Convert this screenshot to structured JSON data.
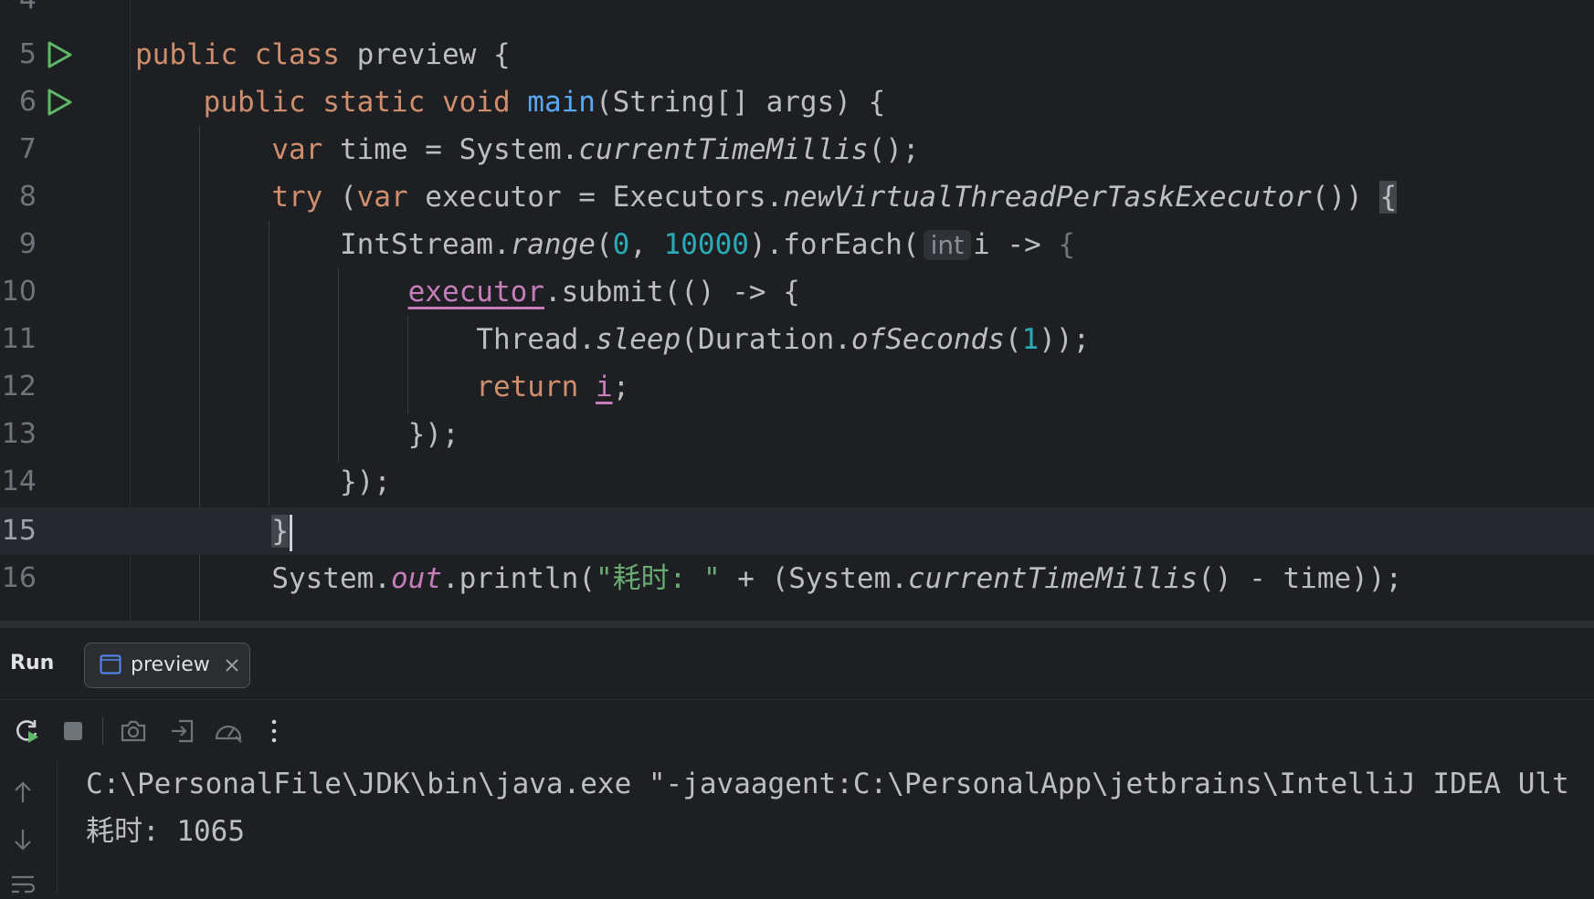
{
  "editor": {
    "lines": [
      {
        "num": "4"
      },
      {
        "num": "5"
      },
      {
        "num": "6"
      },
      {
        "num": "7"
      },
      {
        "num": "8"
      },
      {
        "num": "9"
      },
      {
        "num": "10"
      },
      {
        "num": "11"
      },
      {
        "num": "12"
      },
      {
        "num": "13"
      },
      {
        "num": "14"
      },
      {
        "num": "15"
      },
      {
        "num": "16"
      }
    ],
    "code": {
      "l5": {
        "public": "public",
        "class": "class",
        "name": " preview {"
      },
      "l6": {
        "indent": "    ",
        "public": "public",
        "static": " static",
        "void": " void",
        "main": " main",
        "sig": "(String[] args) {"
      },
      "l7": {
        "indent": "        ",
        "var": "var",
        "rest1": " time = System.",
        "method": "currentTimeMillis",
        "rest2": "();"
      },
      "l8": {
        "indent": "        ",
        "try": "try",
        "paren": " (",
        "var": "var",
        "rest1": " executor = Executors.",
        "method": "newVirtualThreadPerTaskExecutor",
        "rest2": "()) ",
        "brace": "{"
      },
      "l9": {
        "indent": "            ",
        "cls": "IntStream.",
        "range": "range",
        "open": "(",
        "n0": "0",
        "comma": ", ",
        "n1": "10000",
        "rest": ").forEach(",
        "hint": "int",
        "lambda": "i -> ",
        "brace": "{"
      },
      "l10": {
        "indent": "                ",
        "executor": "executor",
        "rest": ".submit(() -> {"
      },
      "l11": {
        "indent": "                    ",
        "cls": "Thread.",
        "sleep": "sleep",
        "mid": "(Duration.",
        "ofSeconds": "ofSeconds",
        "open": "(",
        "n1": "1",
        "close": "));"
      },
      "l12": {
        "indent": "                    ",
        "return": "return",
        "space": " ",
        "i": "i",
        "semi": ";"
      },
      "l13": {
        "indent": "                ",
        "text": "});"
      },
      "l14": {
        "indent": "            ",
        "text": "});"
      },
      "l15": {
        "indent": "        ",
        "brace": "}"
      },
      "l16": {
        "indent": "        ",
        "pre": "System.",
        "out": "out",
        "mid": ".println(",
        "str": "\"耗时: \"",
        "post1": " + (System.",
        "method": "currentTimeMillis",
        "post2": "() - time));"
      }
    }
  },
  "run_panel": {
    "title": "Run",
    "tab_label": "preview",
    "toolbar_icons": [
      "rerun-icon",
      "stop-icon",
      "camera-icon",
      "login-icon",
      "profiler-icon",
      "more-icon"
    ],
    "console": [
      "C:\\PersonalFile\\JDK\\bin\\java.exe \"-javaagent:C:\\PersonalApp\\jetbrains\\IntelliJ IDEA Ult",
      "耗时: 1065"
    ]
  },
  "colors": {
    "background": "#1e1f22",
    "keyword": "#cf8e6d",
    "function": "#56a8f5",
    "number": "#2aacb8",
    "string": "#6aab73",
    "field": "#c77dbb",
    "run_icon": "#5fb865"
  }
}
